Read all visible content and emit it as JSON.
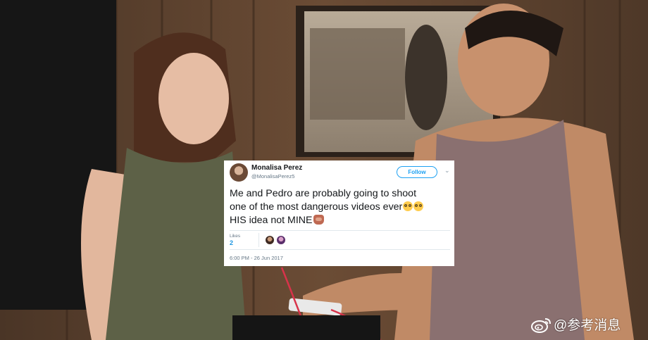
{
  "tweet": {
    "author_name": "Monalisa Perez",
    "author_handle": "@MonalisaPerez5",
    "follow_label": "Follow",
    "text_lines": [
      "Me and Pedro are probably going to shoot",
      "one of the most dangerous videos ever",
      "HIS idea not MINE"
    ],
    "emoji": [
      "flushed-face",
      "flushed-face",
      "see-no-evil-monkey"
    ],
    "likes_label": "Likes",
    "likes_count": "2",
    "timestamp": "6:00 PM - 26 Jun 2017",
    "colors": {
      "accent": "#1da1f2",
      "text": "#14171a",
      "muted": "#657786"
    }
  },
  "watermark": {
    "icon": "weibo-icon",
    "text": "@参考消息"
  }
}
